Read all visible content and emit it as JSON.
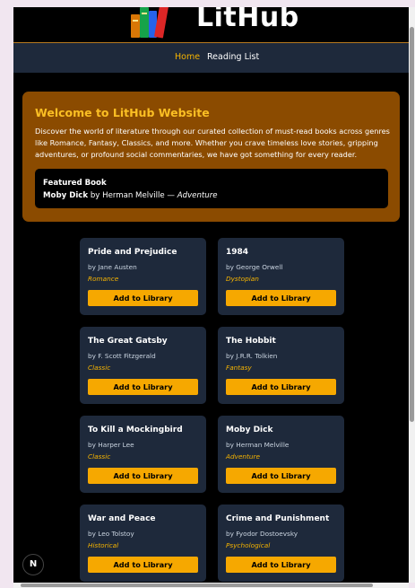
{
  "site": {
    "title": "LitHub",
    "logo_icon": "books-icon"
  },
  "nav": {
    "items": [
      {
        "label": "Home",
        "active": true
      },
      {
        "label": "Reading List",
        "active": false
      }
    ]
  },
  "hero": {
    "title": "Welcome to LitHub Website",
    "text": "Discover the world of literature through our curated collection of must-read books across genres like Romance, Fantasy, Classics, and more. Whether you crave timeless love stories, gripping adventures, or profound social commentaries, we have got something for every reader.",
    "featured": {
      "heading": "Featured Book",
      "title": "Moby Dick",
      "by": "by Herman Melville —",
      "genre": "Adventure"
    }
  },
  "books": [
    {
      "title": "Pride and Prejudice",
      "author": "by Jane Austen",
      "genre": "Romance"
    },
    {
      "title": "1984",
      "author": "by George Orwell",
      "genre": "Dystopian"
    },
    {
      "title": "The Great Gatsby",
      "author": "by F. Scott Fitzgerald",
      "genre": "Classic"
    },
    {
      "title": "The Hobbit",
      "author": "by J.R.R. Tolkien",
      "genre": "Fantasy"
    },
    {
      "title": "To Kill a Mockingbird",
      "author": "by Harper Lee",
      "genre": "Classic"
    },
    {
      "title": "Moby Dick",
      "author": "by Herman Melville",
      "genre": "Adventure"
    },
    {
      "title": "War and Peace",
      "author": "by Leo Tolstoy",
      "genre": "Historical"
    },
    {
      "title": "Crime and Punishment",
      "author": "by Fyodor Dostoevsky",
      "genre": "Psychological"
    }
  ],
  "button_label": "Add to Library",
  "badge": "N",
  "colors": {
    "accent": "#f6a800",
    "hero_bg": "#8b4b00",
    "card_bg": "#1e293b",
    "nav_bg": "#1e293b"
  }
}
